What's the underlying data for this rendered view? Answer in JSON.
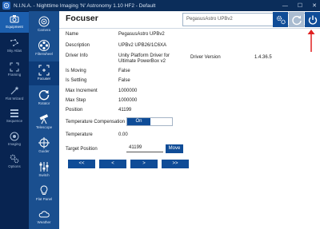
{
  "window": {
    "title": "N.I.N.A. - Nighttime Imaging 'N' Astronomy 1.10 HF2 - Default",
    "minimize": "—",
    "maximize": "☐",
    "close": "✕"
  },
  "nav": {
    "items": [
      {
        "label": "Equipment",
        "icon": "equipment-icon",
        "active": true
      },
      {
        "label": "Sky Atlas",
        "icon": "sky-atlas-icon"
      },
      {
        "label": "Framing",
        "icon": "framing-icon"
      },
      {
        "label": "Flat Wizard",
        "icon": "flat-wizard-icon"
      },
      {
        "label": "Sequence",
        "icon": "sequence-icon"
      },
      {
        "label": "Imaging",
        "icon": "imaging-icon"
      },
      {
        "label": "Options",
        "icon": "options-icon"
      }
    ]
  },
  "subnav": {
    "items": [
      {
        "label": "Camera"
      },
      {
        "label": "Filterwheel"
      },
      {
        "label": "Focuser",
        "active": true
      },
      {
        "label": "Rotator"
      },
      {
        "label": "Telescope"
      },
      {
        "label": "Guider"
      },
      {
        "label": "Switch"
      },
      {
        "label": "Flat Panel"
      },
      {
        "label": "Weather"
      }
    ]
  },
  "header": {
    "heading": "Focuser",
    "device": "PegasusAstro UPBv2",
    "dropdown_arrow": "▾"
  },
  "colors": {
    "accent": "#0f4c97",
    "nav_bg": "#082451",
    "subnav_bg": "#1a4f8f",
    "annotation_arrow": "#e02020"
  },
  "details": {
    "name_label": "Name",
    "name_value": "PegasusAstro UPBv2",
    "description_label": "Description",
    "description_value": "UPBv2 UPB26/1C6XA",
    "driver_info_label": "Driver Info",
    "driver_info_line1": "Unity Platform Driver for",
    "driver_info_line2": "Ultimate PowerBox v2",
    "driver_version_label": "Driver Version",
    "driver_version_value": "1.4.36.5",
    "is_moving_label": "Is Moving",
    "is_moving_value": "False",
    "is_settling_label": "Is Settling",
    "is_settling_value": "False",
    "max_increment_label": "Max Increment",
    "max_increment_value": "1000000",
    "max_step_label": "Max Step",
    "max_step_value": "1000000",
    "position_label": "Position",
    "position_value": "41199",
    "temp_comp_label": "Temperature Compensation",
    "temp_comp_value": "On",
    "temperature_label": "Temperature",
    "temperature_value": "0.00",
    "target_position_label": "Target Position",
    "target_position_value": "41199",
    "move_label": "Move"
  },
  "steps": {
    "big_left": "<<",
    "left": "<",
    "right": ">",
    "big_right": ">>"
  }
}
